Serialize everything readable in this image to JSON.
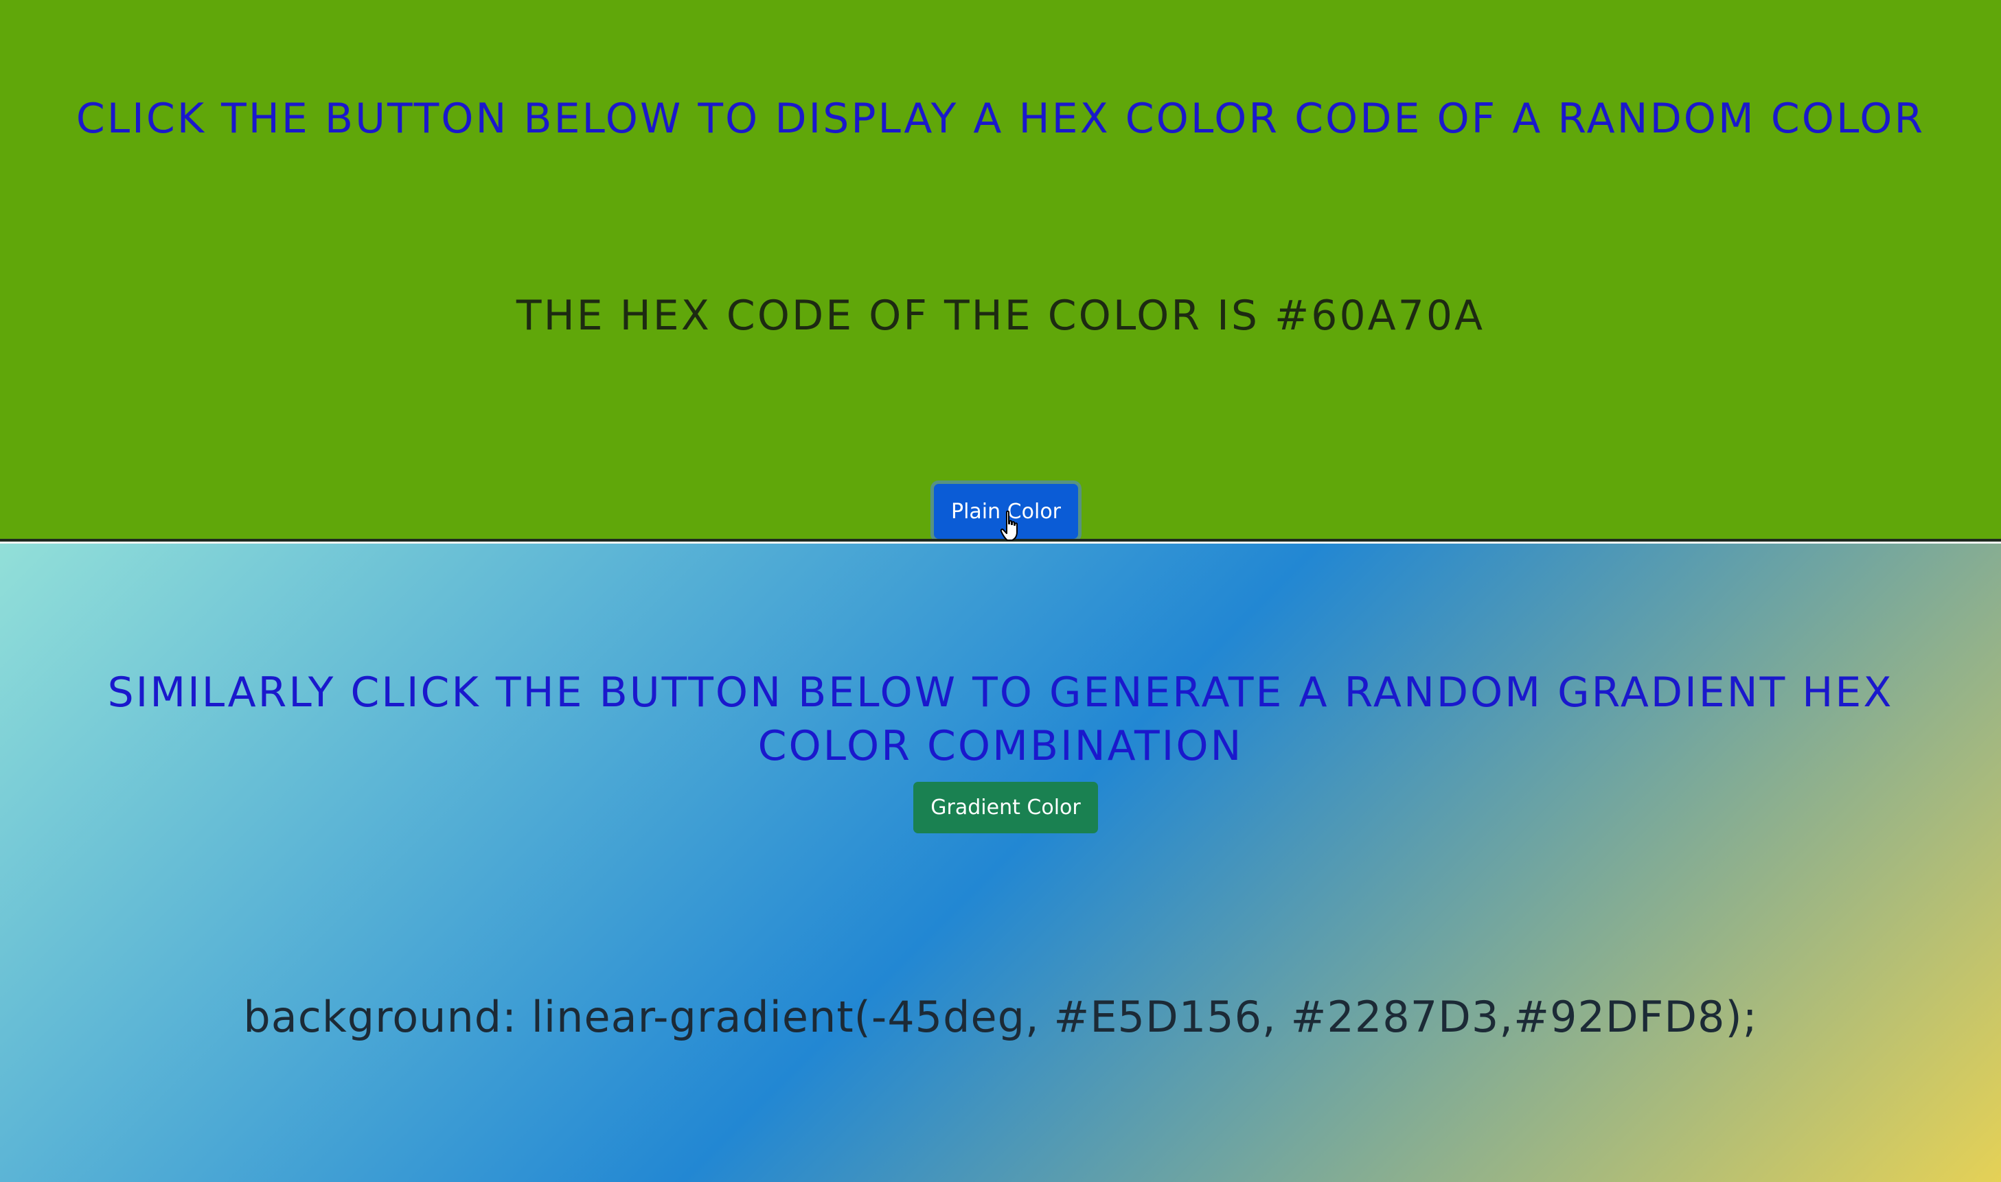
{
  "plain": {
    "heading": "Click the button below to display a hex color code of a random color",
    "hex_text": "The hex code of the color is #60A70A",
    "button_label": "Plain Color",
    "background_color": "#60A70A"
  },
  "gradient": {
    "heading": "Similarly click the button below to generate a random gradient hex color combination",
    "button_label": "Gradient Color",
    "css_text": "background: linear-gradient(-45deg, #E5D156, #2287D3,#92DFD8);",
    "colors": [
      "#E5D156",
      "#2287D3",
      "#92DFD8"
    ]
  },
  "colors": {
    "heading": "#1a18cc",
    "plain_button": "#0b5cd6",
    "gradient_button": "#1a8151"
  },
  "icons": {
    "cursor": "hand-pointer-icon"
  }
}
